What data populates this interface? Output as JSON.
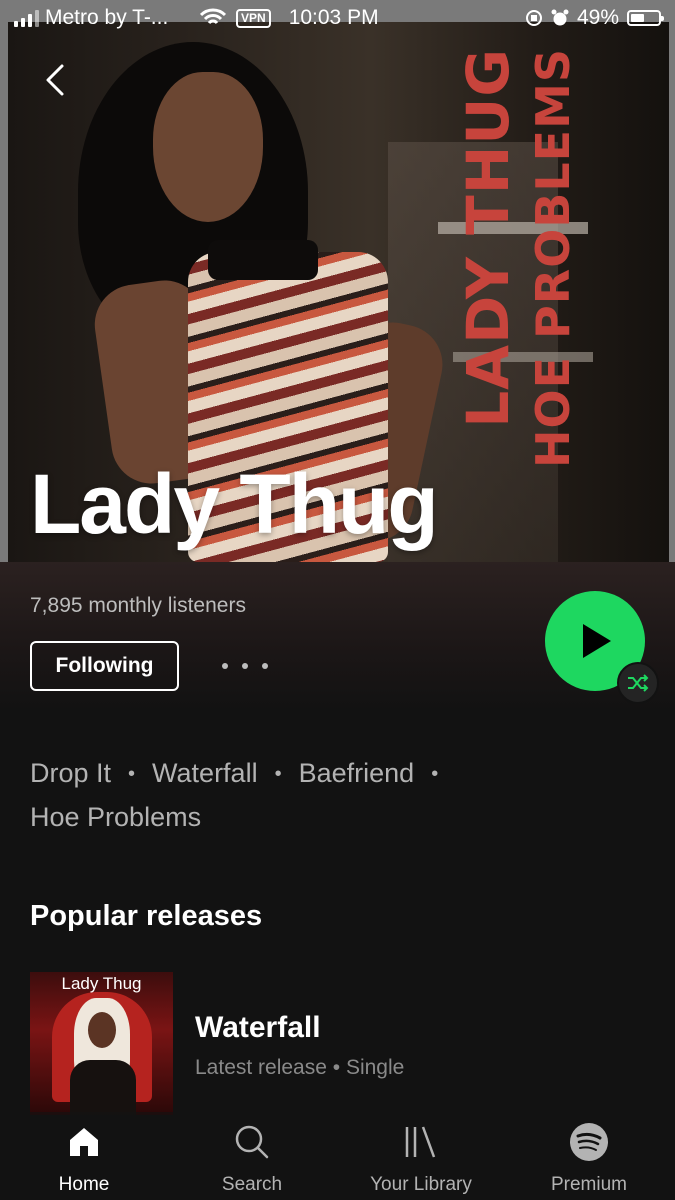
{
  "status_bar": {
    "carrier": "Metro by T-...",
    "vpn": "VPN",
    "time": "10:03 PM",
    "battery": "49%"
  },
  "artist": {
    "name": "Lady Thug",
    "monthly_listeners": "7,895 monthly listeners",
    "follow_label": "Following"
  },
  "album_art": {
    "line1": "LADY THUG",
    "line2": "HOE PROBLEMS"
  },
  "popular_tracks": [
    "Drop It",
    "Waterfall",
    "Baefriend",
    "Hoe Problems"
  ],
  "sections": {
    "popular_releases": "Popular releases"
  },
  "release": {
    "cover_text": "Lady Thug",
    "title": "Waterfall",
    "subtitle": "Latest release • Single"
  },
  "nav": {
    "items": [
      {
        "label": "Home",
        "icon": "home-icon",
        "active": true
      },
      {
        "label": "Search",
        "icon": "search-icon",
        "active": false
      },
      {
        "label": "Your Library",
        "icon": "library-icon",
        "active": false
      },
      {
        "label": "Premium",
        "icon": "spotify-icon",
        "active": false
      }
    ]
  },
  "colors": {
    "accent": "#1ed760",
    "background": "#121212",
    "album_text": "#c7443c"
  }
}
